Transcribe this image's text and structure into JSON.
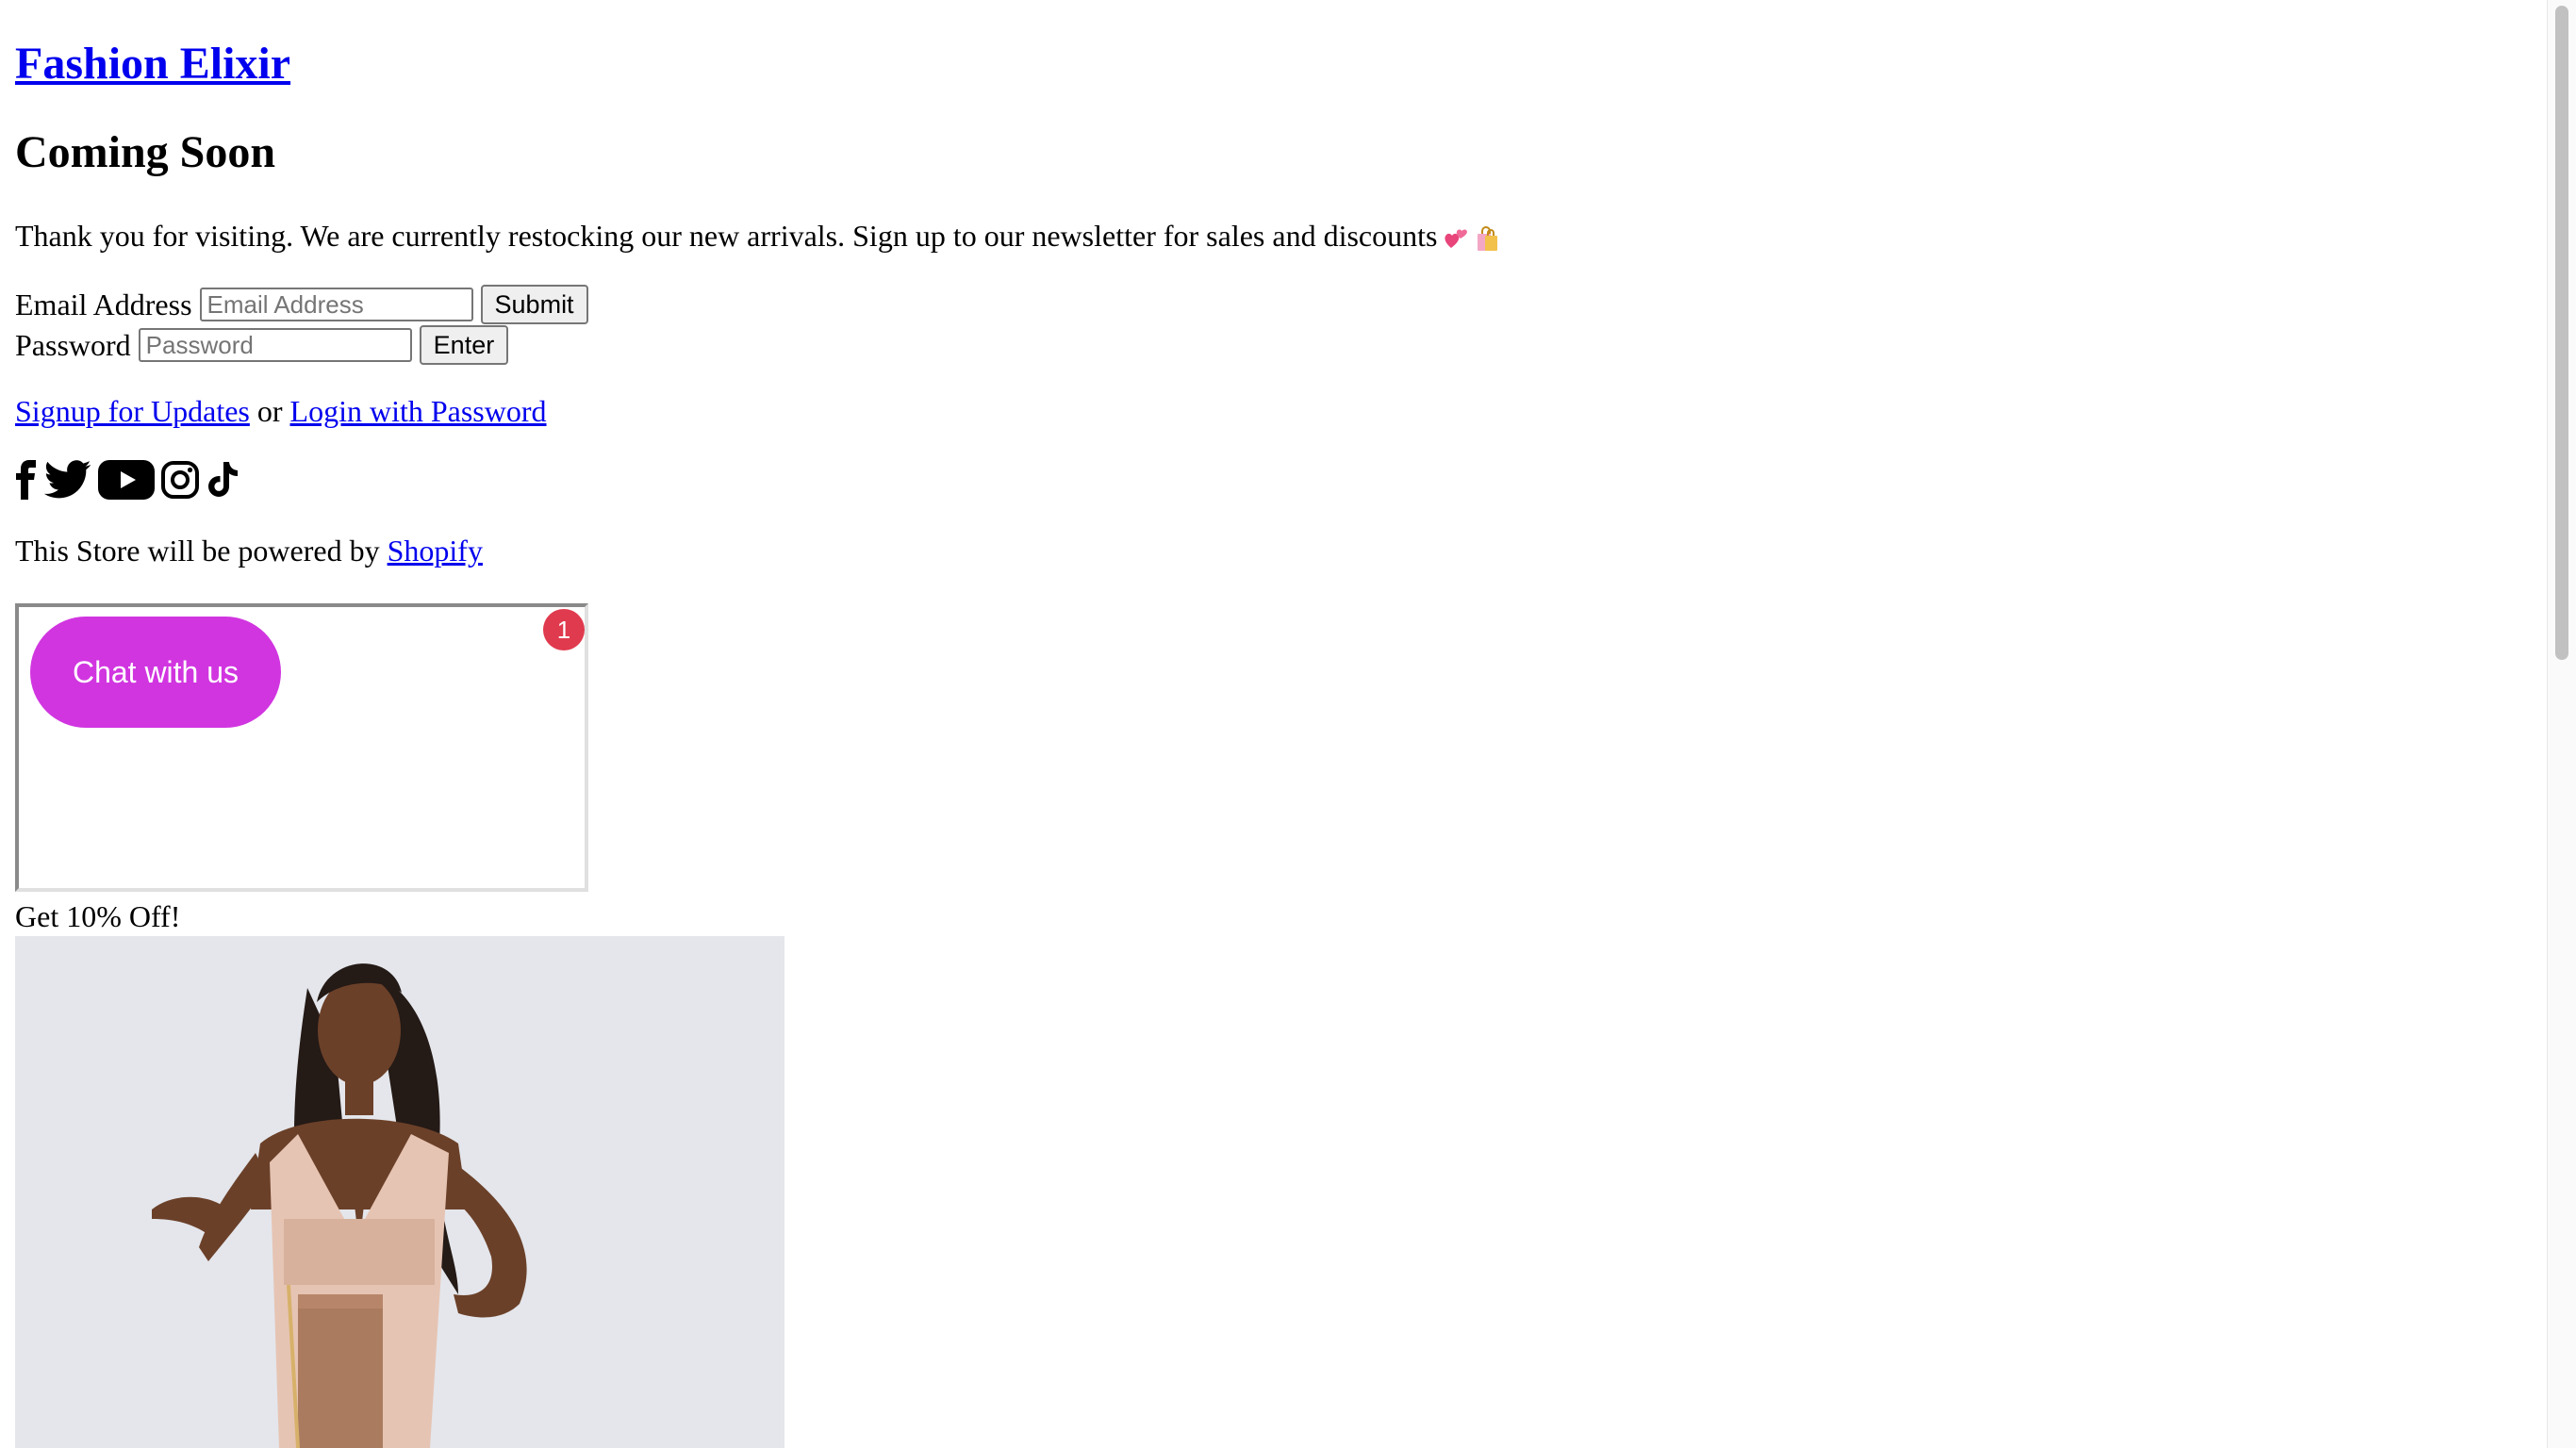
{
  "store": {
    "title": "Fashion Elixir"
  },
  "heading": "Coming Soon",
  "intro": {
    "text": "Thank you for visiting. We are currently restocking our new arrivals. Sign up to our newsletter for sales and discounts",
    "emoji": [
      "💕",
      "🛍️"
    ]
  },
  "signup_form": {
    "email_label": "Email Address",
    "email_placeholder": "Email Address",
    "submit_label": "Submit"
  },
  "password_form": {
    "password_label": "Password",
    "password_placeholder": "Password",
    "enter_label": "Enter"
  },
  "links": {
    "signup": "Signup for Updates",
    "separator": "or",
    "login": "Login with Password"
  },
  "social": {
    "icons": [
      "facebook-icon",
      "twitter-icon",
      "youtube-icon",
      "instagram-icon",
      "tiktok-icon"
    ]
  },
  "powered_by": {
    "prefix": "This Store will be powered by",
    "link": "Shopify"
  },
  "chat_widget": {
    "button_label": "Chat with us",
    "badge_count": "1",
    "button_color": "#d135e0",
    "badge_color": "#e03a4e"
  },
  "promo": {
    "text": "Get 10% Off!"
  },
  "colors": {
    "link": "#0000ee",
    "background": "#ffffff"
  }
}
